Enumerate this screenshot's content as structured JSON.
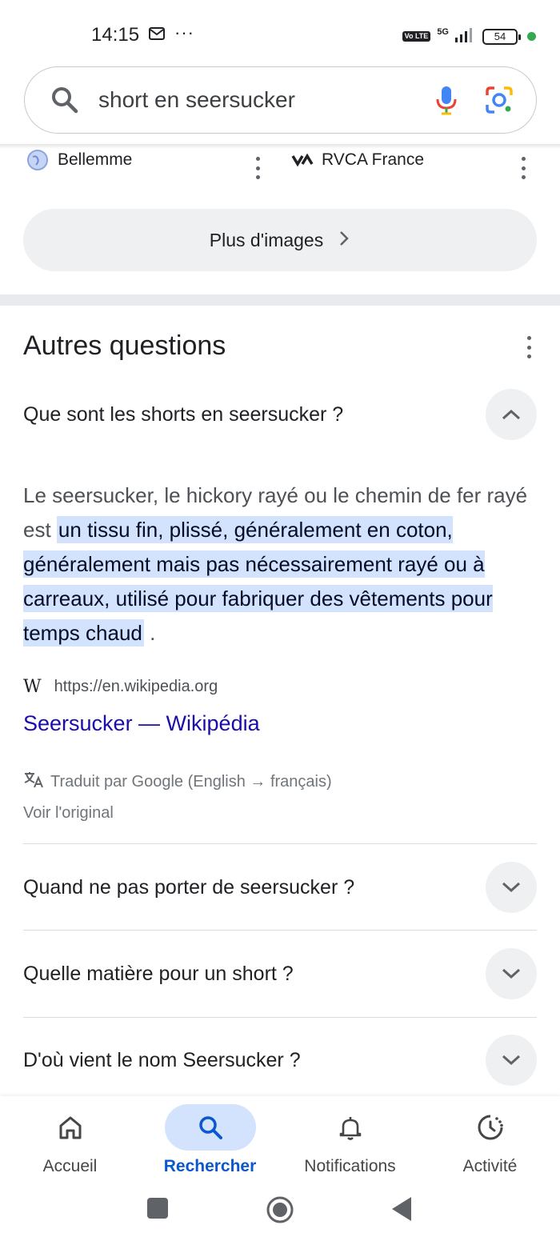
{
  "status_bar": {
    "time": "14:15",
    "dots": "···",
    "volte": "Vo LTE",
    "network": "5G",
    "battery": "54"
  },
  "search": {
    "query": "short en seersucker"
  },
  "image_sources": [
    {
      "name": "Bellemme"
    },
    {
      "name": "RVCA France"
    }
  ],
  "more_images": {
    "label": "Plus d'images"
  },
  "questions": {
    "title": "Autres questions",
    "expanded": {
      "question": "Que sont les shorts en seersucker ?",
      "answer_plain": "Le seersucker, le hickory rayé ou le chemin de fer rayé est ",
      "answer_highlight": "un tissu fin, plissé, généralement en coton, généralement mais pas nécessairement rayé ou à carreaux, utilisé pour fabriquer des vêtements pour temps chaud",
      "answer_end": " .",
      "source_url": "https://en.wikipedia.org",
      "source_title": "Seersucker — Wikipédia",
      "translated_note": "Traduit par Google (English → français)",
      "see_original": "Voir l'original"
    },
    "collapsed": [
      {
        "question": "Quand ne pas porter de seersucker ?"
      },
      {
        "question": "Quelle matière pour un short ?"
      },
      {
        "question": "D'où vient le nom Seersucker ?"
      }
    ]
  },
  "bottom_nav": [
    {
      "label": "Accueil",
      "icon": "home-icon",
      "active": false
    },
    {
      "label": "Rechercher",
      "icon": "search-icon",
      "active": true
    },
    {
      "label": "Notifications",
      "icon": "bell-icon",
      "active": false
    },
    {
      "label": "Activité",
      "icon": "activity-icon",
      "active": false
    }
  ],
  "colors": {
    "accent": "#0b57d0",
    "highlight": "#d3e3fd",
    "link": "#1a0dab"
  }
}
